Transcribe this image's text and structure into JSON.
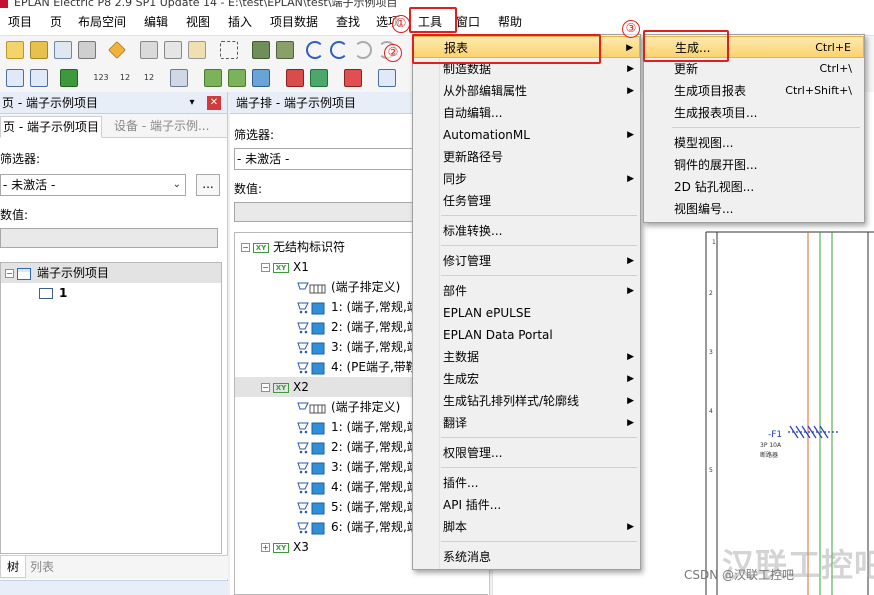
{
  "window": {
    "title": "EPLAN Electric P8 2.9 SP1 Update 14 - E:\\test\\EPLAN\\test\\端子示例项目"
  },
  "menubar": [
    "项目",
    "页",
    "布局空间",
    "编辑",
    "视图",
    "插入",
    "项目数据",
    "查找",
    "选项",
    "工具",
    "窗口",
    "帮助"
  ],
  "left_panel": {
    "title": "页 - 端子示例项目",
    "pin_icon": "📌",
    "close_icon": "✕",
    "tabs": [
      "页 - 端子示例项目",
      "设备 - 端子示例..."
    ],
    "filter_label": "筛选器:",
    "filter_value": "- 未激活 -",
    "more_button": "...",
    "value_label": "数值:",
    "tree": [
      {
        "label": "端子示例项目",
        "expander": "−"
      },
      {
        "label": "1"
      }
    ],
    "bottom_tabs": [
      "树",
      "列表"
    ]
  },
  "mid_panel": {
    "title": "端子排 - 端子示例项目",
    "filter_label": "筛选器:",
    "filter_value": "- 未激活 -",
    "value_label": "数值:",
    "tree": [
      {
        "label": "无结构标识符",
        "expander": "−",
        "icon": "XY"
      },
      {
        "label": "X1",
        "expander": "−",
        "icon": "XY"
      },
      {
        "label": "(端子排定义)",
        "type": "strip"
      },
      {
        "label": "1: (端子,常规,端",
        "type": "term"
      },
      {
        "label": "2: (端子,常规,端",
        "type": "term"
      },
      {
        "label": "3: (端子,常规,端",
        "type": "term"
      },
      {
        "label": "4: (PE端子,带鞍",
        "type": "term"
      },
      {
        "label": "X2",
        "expander": "−",
        "icon": "XY"
      },
      {
        "label": "(端子排定义)",
        "type": "strip"
      },
      {
        "label": "1: (端子,常规,端",
        "type": "term"
      },
      {
        "label": "2: (端子,常规,端",
        "type": "term"
      },
      {
        "label": "3: (端子,常规,端",
        "type": "term"
      },
      {
        "label": "4: (端子,常规,端",
        "type": "term"
      },
      {
        "label": "5: (端子,常规,端",
        "type": "term"
      },
      {
        "label": "6: (端子,常规,端",
        "type": "term"
      },
      {
        "label": "X3",
        "expander": "+",
        "icon": "XY"
      }
    ]
  },
  "tools_menu": [
    {
      "label": "报表",
      "arrow": true,
      "highlighted": true
    },
    {
      "label": "制造数据",
      "arrow": true
    },
    {
      "label": "从外部编辑属性",
      "arrow": true
    },
    {
      "label": "自动编辑...",
      "arrow": false
    },
    {
      "label": "AutomationML",
      "arrow": true
    },
    {
      "label": "更新路径号",
      "arrow": false
    },
    {
      "label": "同步",
      "arrow": true
    },
    {
      "label": "任务管理",
      "arrow": false
    },
    {
      "sep": true
    },
    {
      "label": "标准转换...",
      "arrow": false
    },
    {
      "sep": true
    },
    {
      "label": "修订管理",
      "arrow": true
    },
    {
      "sep": true
    },
    {
      "label": "部件",
      "arrow": true
    },
    {
      "label": "EPLAN ePULSE",
      "arrow": false
    },
    {
      "label": "EPLAN Data Portal",
      "arrow": false
    },
    {
      "label": "主数据",
      "arrow": true
    },
    {
      "label": "生成宏",
      "arrow": true
    },
    {
      "label": "生成钻孔排列样式/轮廓线",
      "arrow": true
    },
    {
      "label": "翻译",
      "arrow": true
    },
    {
      "sep": true
    },
    {
      "label": "权限管理...",
      "arrow": false
    },
    {
      "sep": true
    },
    {
      "label": "插件...",
      "arrow": false
    },
    {
      "label": "API 插件...",
      "arrow": false
    },
    {
      "label": "脚本",
      "arrow": true
    },
    {
      "sep": true
    },
    {
      "label": "系统消息",
      "arrow": false
    }
  ],
  "reports_submenu": [
    {
      "label": "生成...",
      "shortcut": "Ctrl+E",
      "highlighted": true
    },
    {
      "label": "更新",
      "shortcut": "Ctrl+\\"
    },
    {
      "label": "生成项目报表",
      "shortcut": "Ctrl+Shift+\\"
    },
    {
      "label": "生成报表项目...",
      "shortcut": ""
    },
    {
      "sep": true
    },
    {
      "label": "模型视图...",
      "shortcut": ""
    },
    {
      "label": "铜件的展开图...",
      "shortcut": ""
    },
    {
      "label": "2D 钻孔视图...",
      "shortcut": ""
    },
    {
      "label": "视图编号...",
      "shortcut": ""
    }
  ],
  "annotations": {
    "step1": "①",
    "step2": "②",
    "step3": "③"
  },
  "canvas": {
    "device_label": "-F1",
    "device_sub1": "3P 10A",
    "device_sub2": "断路器",
    "ruler": [
      "1",
      "2",
      "3",
      "4",
      "5"
    ]
  },
  "watermark": {
    "csdn": "CSDN @汉联工控吧",
    "brand": "汉联工控吧"
  },
  "colors": {
    "highlight": "#fbd36e",
    "annotation_red": "#e0201c",
    "tree_xy_green": "#3c9a3c"
  }
}
